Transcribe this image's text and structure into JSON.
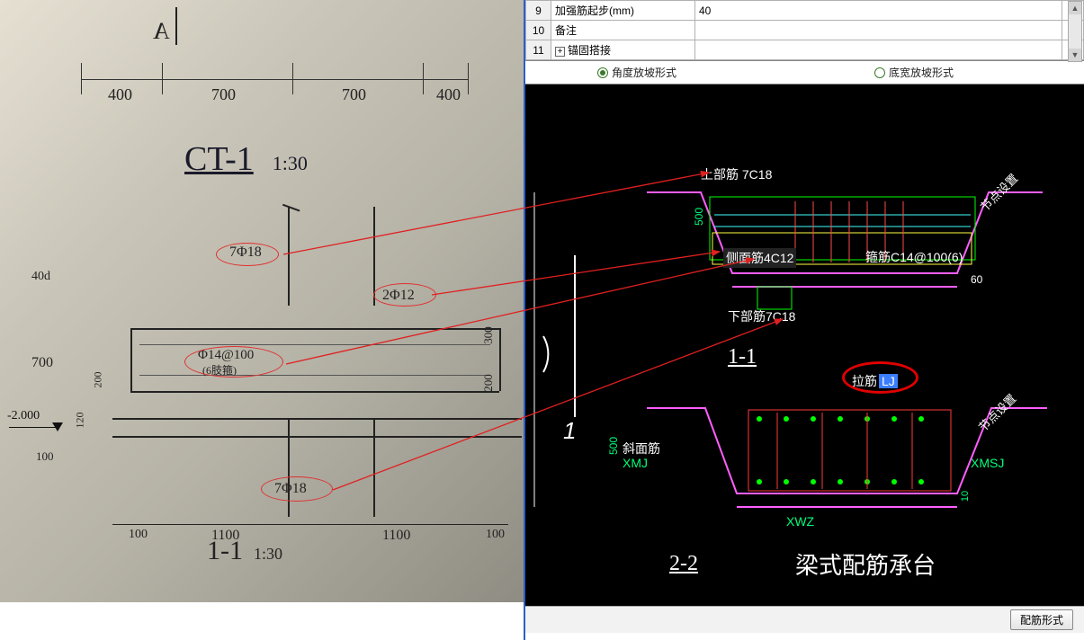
{
  "left": {
    "dim_labels": [
      "400",
      "700",
      "700",
      "400"
    ],
    "title": "CT-1",
    "title_scale": "1:30",
    "callouts": {
      "top_rebar": "7Φ18",
      "side_rebar": "2Φ12",
      "stirrup": "Φ14@100",
      "stirrup_sub": "(6肢箍)",
      "bottom_rebar": "7Φ18"
    },
    "v_dims": {
      "d40d": "40d",
      "d700": "700",
      "d100": "100",
      "d120": "120",
      "d200": "200",
      "d300": "300"
    },
    "bottom_dims": [
      "100",
      "1100",
      "1100",
      "100"
    ],
    "footer_title": "1-1",
    "footer_scale": "1:30",
    "elev": "-2.000"
  },
  "table": {
    "rows": [
      {
        "num": "9",
        "label": "加强筋起步(mm)",
        "value": "40",
        "check": false
      },
      {
        "num": "10",
        "label": "备注",
        "value": "",
        "check": false
      },
      {
        "num": "11",
        "label": "锚固搭接",
        "value": "",
        "expand": true
      }
    ]
  },
  "radios": {
    "opt1": "角度放坡形式",
    "opt2": "底宽放坡形式",
    "selected": "opt1"
  },
  "cad": {
    "top_label": "上部筋",
    "top_val": "7C18",
    "side_label": "侧面筋",
    "side_val": "4C12",
    "stirrup_label": "箍筋",
    "stirrup_val": "C14@100(6)",
    "bottom_label": "下部筋",
    "bottom_val": "7C18",
    "lajin_label": "拉筋",
    "lajin_val": "LJ",
    "sec1": "1-1",
    "sec2": "2-2",
    "angle": "60",
    "dim500": "500",
    "dim10": "10",
    "xmj": "XMJ",
    "xmsj": "XMSJ",
    "xwz": "XWZ",
    "xiemj_label": "斜面筋",
    "jdset": "节点设置",
    "big_title": "梁式配筋承台",
    "num1": "1"
  },
  "button": "配筋形式"
}
